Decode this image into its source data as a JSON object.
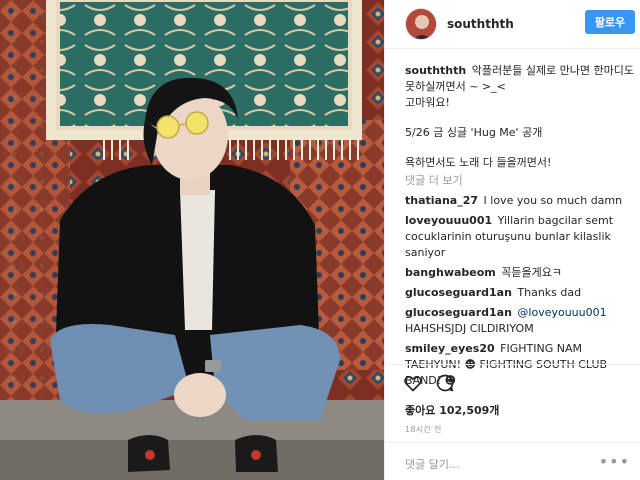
{
  "header": {
    "username": "souththth",
    "follow_label": "팔로우"
  },
  "caption": {
    "username": "souththth",
    "line1": "악플러분들 실제로 만나면 한마디도 못하실꺼면서 ~ >_<",
    "line2": "고마워요!",
    "line3": "5/26 금 싱글 'Hug Me' 공개",
    "line4": "욕하면서도 노래 다 들을꺼면서!"
  },
  "more_comments": "댓글 더 보기",
  "comments": [
    {
      "user": "thatiana_27",
      "text": "I love you so much damn"
    },
    {
      "user": "loveyouuu001",
      "text": "Yillarin bagcilar semt cocuklarinin oturuşunu bunlar kilaslik saniyor"
    },
    {
      "user": "banghwabeom",
      "text": "꼭듣을게요ㅋ"
    },
    {
      "user": "glucoseguard1an",
      "text": "Thanks dad"
    },
    {
      "user": "glucoseguard1an",
      "mention": "@loveyouuu001",
      "text": "HAHSHSJDJ CILDIRIYOM"
    },
    {
      "user": "smiley_eyes20",
      "text": "FIGHTING NAM TAEHYUN! ☻ FIGHTING SOUTH CLUB BAND! ☻"
    }
  ],
  "actions": {
    "like_icon": "heart-icon",
    "comment_icon": "comment-bubble-icon"
  },
  "likes": "좋아요 102,509개",
  "timestamp": "18시간 전",
  "add_comment_placeholder": "댓글 달기...",
  "more_options": "•••",
  "colors": {
    "follow_button": "#3897f0",
    "text": "#262626",
    "muted": "#999999",
    "border": "#efefef"
  }
}
